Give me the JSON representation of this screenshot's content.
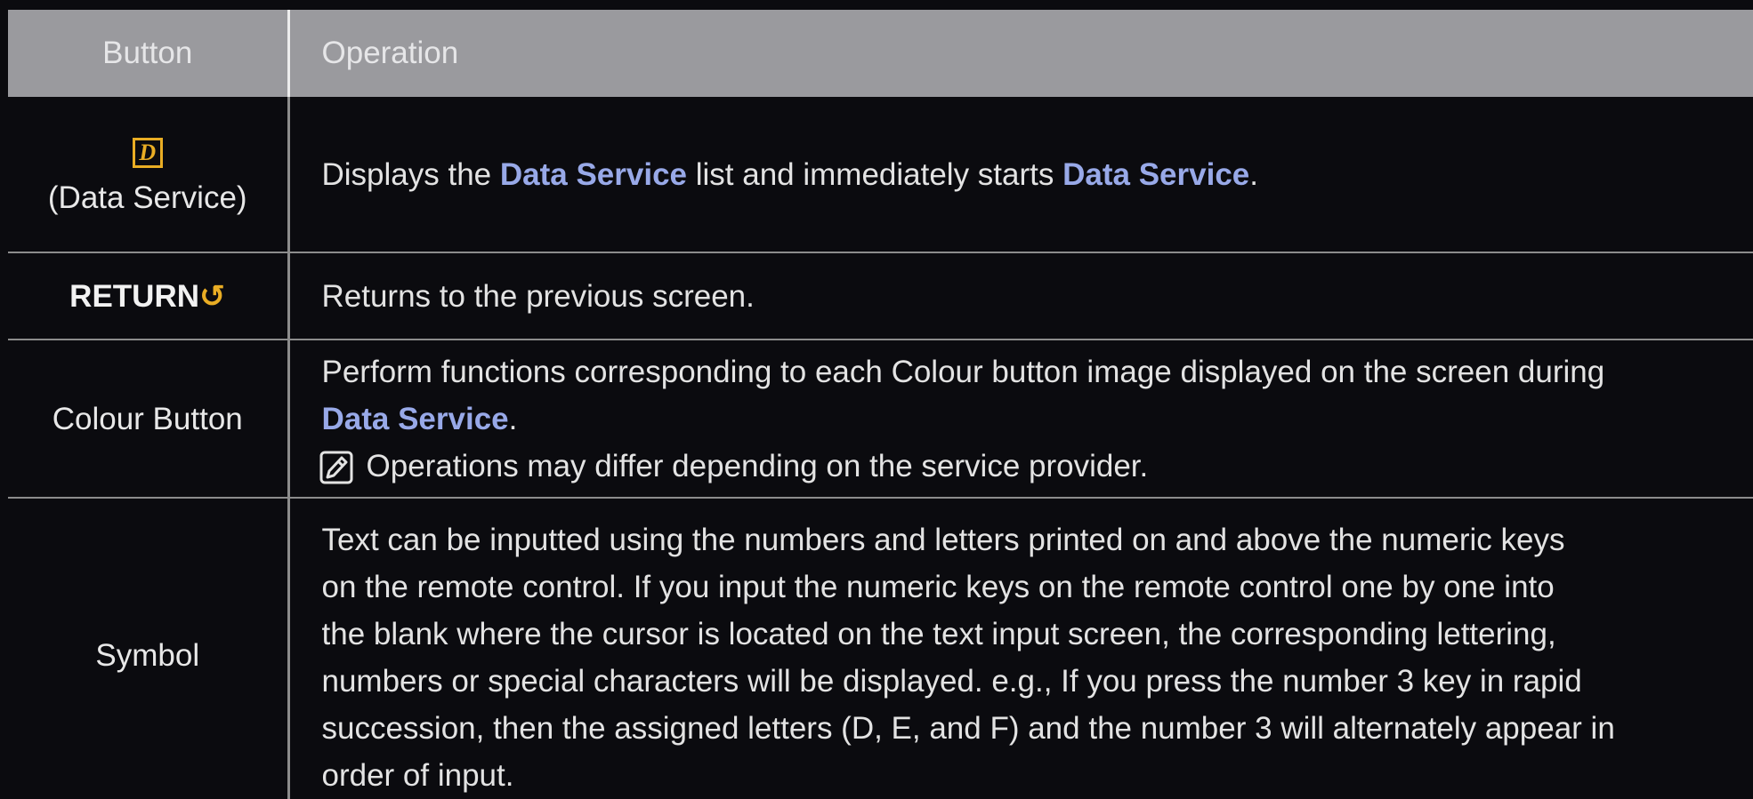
{
  "table": {
    "headers": {
      "button": "Button",
      "operation": "Operation"
    },
    "rows": [
      {
        "button_label": "(Data Service)",
        "icon": "data-service-icon",
        "icon_glyph": "D",
        "op_parts": [
          "Displays the ",
          "Data Service",
          " list and immediately starts ",
          "Data Service",
          "."
        ]
      },
      {
        "button_label": "RETURN",
        "icon": "return-arrow-icon",
        "icon_glyph": "↺",
        "op_text": "Returns to the previous screen."
      },
      {
        "button_label": "Colour Button",
        "op_text_1": "Perform functions corresponding to each Colour button image displayed on the screen during",
        "op_link": "Data Service",
        "op_period": ".",
        "note": "Operations may differ depending on the service provider.",
        "note_icon": "note-pencil-icon"
      },
      {
        "button_label": "Symbol",
        "op_lines": [
          "Text can be inputted using the numbers and letters printed on and above the numeric keys",
          "on the remote control. If you input the numeric keys on the remote control one by one into",
          "the blank where the cursor is located on the text input screen, the corresponding lettering,",
          "numbers or special characters will be displayed. e.g., If you press the number 3 key in rapid",
          "succession, then the assigned letters (D, E, and F) and the number 3 will alternately appear in",
          "order of input."
        ]
      }
    ]
  },
  "colors": {
    "background": "#0b0b0f",
    "header_bg": "#9a9a9e",
    "highlight": "#98a9e8",
    "icon_accent": "#e9ad24"
  }
}
